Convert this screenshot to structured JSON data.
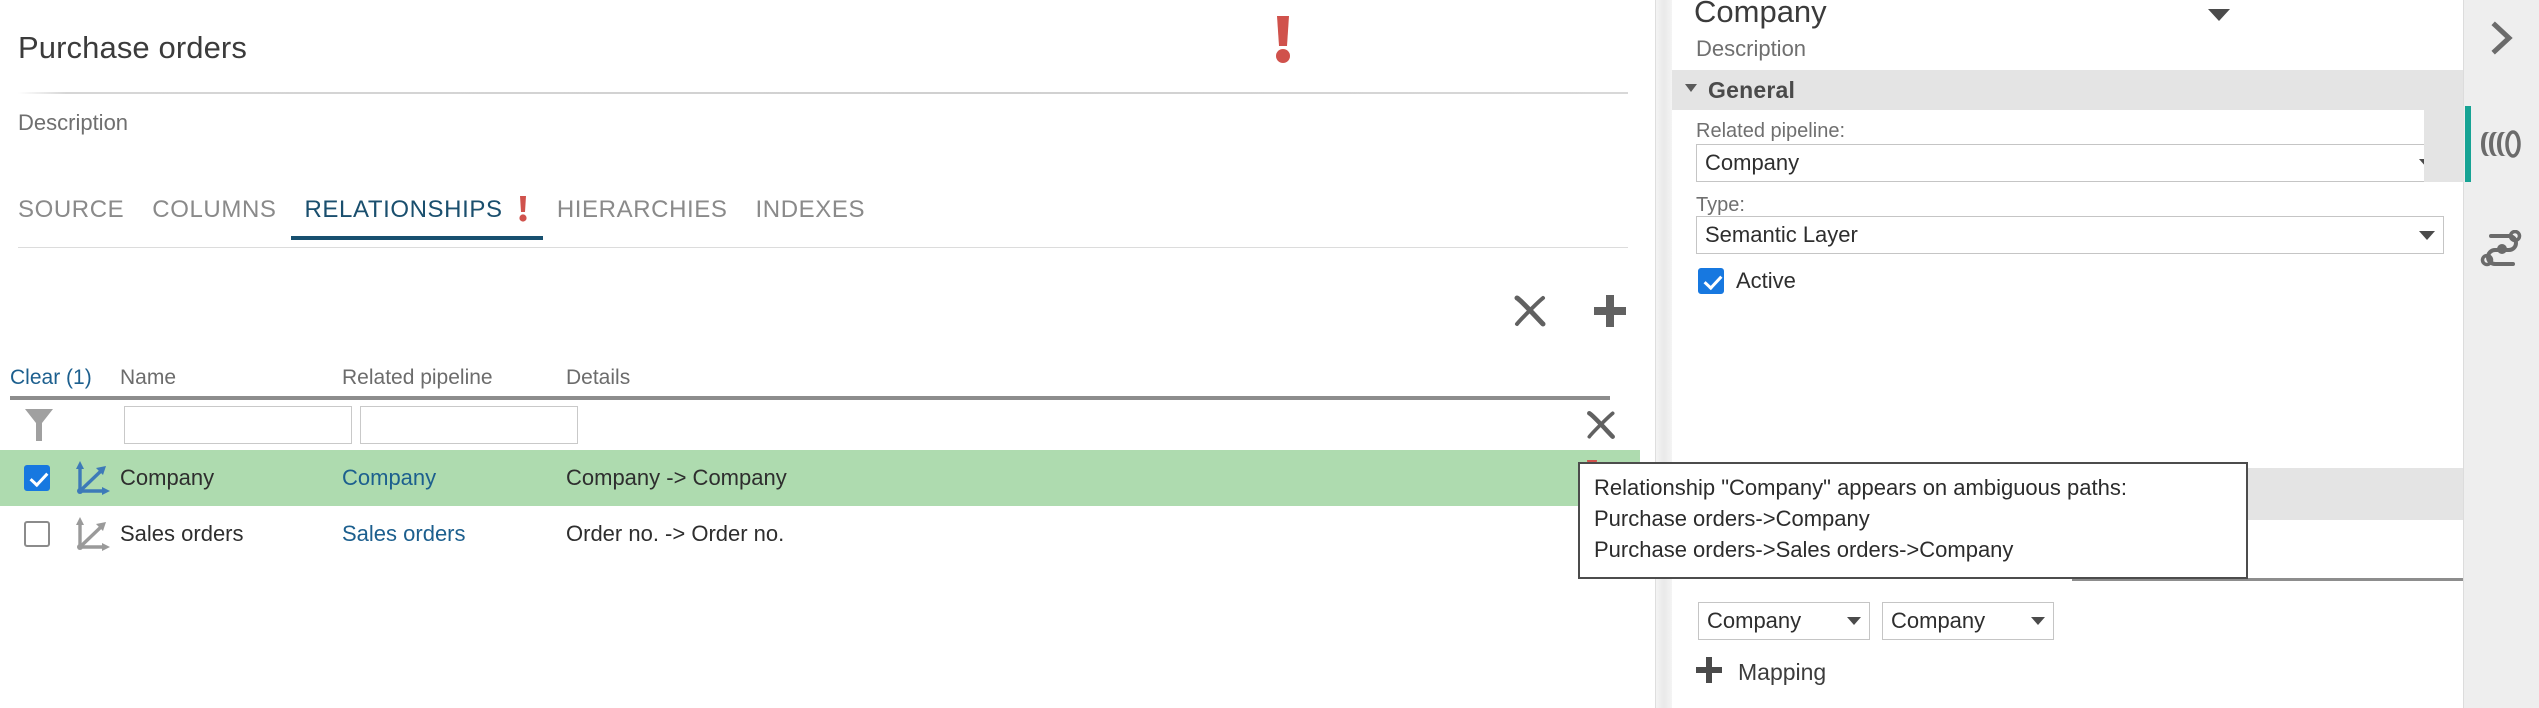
{
  "page": {
    "title": "Purchase orders",
    "description": "Description",
    "warning_icon": "warning-exclamation-icon"
  },
  "tabs": [
    {
      "label": "SOURCE",
      "active": false,
      "warning": false
    },
    {
      "label": "COLUMNS",
      "active": false,
      "warning": false
    },
    {
      "label": "RELATIONSHIPS",
      "active": true,
      "warning": true
    },
    {
      "label": "HIERARCHIES",
      "active": false,
      "warning": false
    },
    {
      "label": "INDEXES",
      "active": false,
      "warning": false
    }
  ],
  "toolbar": {
    "delete_label": "delete-relationship",
    "add_label": "add-relationship"
  },
  "grid": {
    "clear_label": "Clear (1)",
    "columns": [
      "Name",
      "Related pipeline",
      "Details"
    ],
    "filter": {
      "name_value": "",
      "related_pipeline_value": "",
      "name_placeholder": "",
      "related_pipeline_placeholder": ""
    },
    "rows": [
      {
        "checked": true,
        "name": "Company",
        "related_pipeline": "Company",
        "details": "Company -> Company",
        "warning": true,
        "selected": true
      },
      {
        "checked": false,
        "name": "Sales orders",
        "related_pipeline": "Sales orders",
        "details": "Order no. -> Order no.",
        "warning": true,
        "selected": false
      }
    ]
  },
  "tooltip": {
    "line1": "Relationship \"Company\" appears on ambiguous paths:",
    "line2": "Purchase orders->Company",
    "line3": "Purchase orders->Sales orders->Company"
  },
  "properties": {
    "title": "Company",
    "description": "Description",
    "section_general": "General",
    "related_pipeline_label": "Related pipeline:",
    "related_pipeline_value": "Company",
    "type_label": "Type:",
    "type_value": "Semantic Layer",
    "active_label": "Active",
    "active_checked": true,
    "mapping_left_value": "Company",
    "mapping_right_value": "Company",
    "add_mapping_label": "Mapping"
  },
  "rail": {
    "items": [
      {
        "icon": "chevron-right-icon",
        "active": false
      },
      {
        "icon": "database-layers-icon",
        "active": true
      },
      {
        "icon": "pipeline-flow-icon",
        "active": false
      }
    ]
  },
  "colors": {
    "accent_blue": "#17506f",
    "link_blue": "#1c5f8e",
    "warning_red": "#d0524c",
    "selection_green": "#aedbaf",
    "checkbox_blue": "#1778e0",
    "rail_active_teal": "#16a394"
  }
}
